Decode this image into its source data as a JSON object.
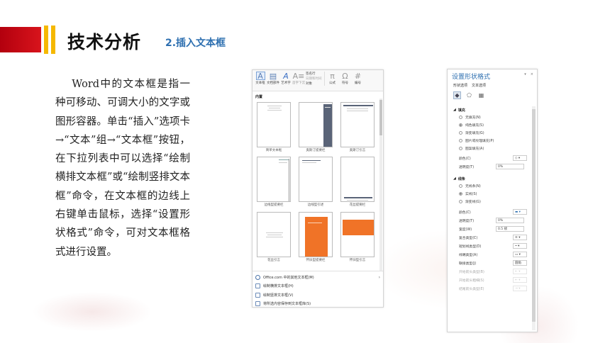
{
  "header": {
    "title": "技术分析",
    "subtitle": "2.插入文本框"
  },
  "body_text": "Word中的文本框是指一种可移动、可调大小的文字或图形容器。单击“插入”选项卡→“文本”组→“文本框”按钮，在下拉列表中可以选择“绘制横排文本框”或“绘制竖排文本框”命令，在文本框的边线上右键单击鼠标，选择“设置形状格式”命令，可对文本框格式进行设置。",
  "word_panel": {
    "ribbon": {
      "textbox": "文本框",
      "doc_parts": "文档部件",
      "wordart": "艺术字",
      "dropcap": "首字下沉",
      "signature": "签名行",
      "datetime": "日期和时间",
      "object": "对象",
      "equation": "公式",
      "symbol": "符号",
      "number": "编号"
    },
    "section_label": "内置",
    "thumbnails": [
      "简单文本框",
      "奥斯汀提要栏",
      "奥斯汀引言",
      "边线型提要栏",
      "边线型引述",
      "花丝提要栏",
      "花丝引言",
      "怀旧型提要栏",
      "怀旧型引言"
    ],
    "menu": [
      "Office.com 中的其他文本框(M)",
      "绘制横排文本框(H)",
      "绘制竖排文本框(V)",
      "将所选内容保存到文本框库(S)"
    ]
  },
  "format_pane": {
    "title": "设置形状格式",
    "tabs": [
      "形状选项",
      "文本选项"
    ],
    "fill": {
      "heading": "填充",
      "options": [
        "无填充(N)",
        "纯色填充(S)",
        "渐变填充(G)",
        "图片或纹理填充(P)",
        "图案填充(A)"
      ],
      "color_label": "颜色(C)",
      "transparency_label": "透明度(T)",
      "transparency_value": "0%"
    },
    "line": {
      "heading": "线条",
      "options": [
        "无线条(N)",
        "实线(S)",
        "渐变线(G)"
      ],
      "color_label": "颜色(C)",
      "transparency_label": "透明度(T)",
      "transparency_value": "0%",
      "width_label": "宽度(W)",
      "width_value": "0.5 磅",
      "compound_label": "复合类型(C)",
      "dash_label": "短划线类型(D)",
      "cap_label": "线端类型(A)",
      "join_label": "联接类型(J)",
      "join_value": "圆角",
      "begin_arrow_type": "开始箭头类型(B)",
      "begin_arrow_size": "开始箭头粗细(S)",
      "end_arrow_type": "结尾箭头类型(E)"
    }
  }
}
